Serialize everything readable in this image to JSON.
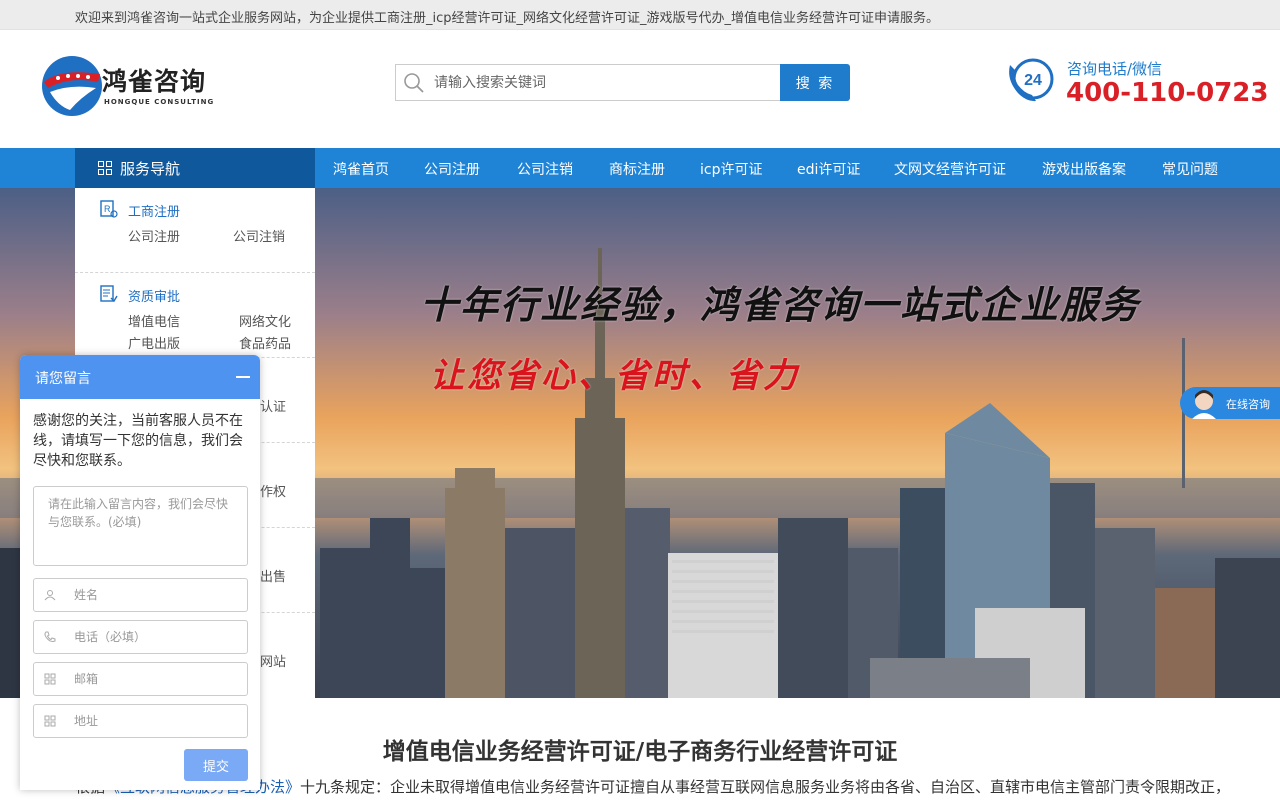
{
  "topbar": {
    "welcome_text": "欢迎来到鸿雀咨询一站式企业服务网站，为企业提供工商注册_icp经营许可证_网络文化经营许可证_游戏版号代办_增值电信业务经营许可证申请服务。"
  },
  "header": {
    "logo": {
      "title": "鸿雀咨询",
      "subtitle": "HONGQUE CONSULTING",
      "brand_color": "#1f6fc2"
    },
    "search": {
      "placeholder": "请输入搜索关键词",
      "button_label": "搜 索",
      "icon": "search-icon"
    },
    "hotline": {
      "badge": "24",
      "label": "咨询电话/微信",
      "number": "400-110-0723",
      "number_color": "#d92027"
    }
  },
  "nav": {
    "service_nav_label": "服务导航",
    "items": [
      {
        "label": "鸿雀首页"
      },
      {
        "label": "公司注册"
      },
      {
        "label": "公司注销"
      },
      {
        "label": "商标注册"
      },
      {
        "label": "icp许可证"
      },
      {
        "label": "edi许可证"
      },
      {
        "label": "文网文经营许可证"
      },
      {
        "label": "游戏出版备案"
      },
      {
        "label": "常见问题"
      }
    ],
    "bar_color": "#1f84d6",
    "head_color": "#10589c"
  },
  "service_menu": {
    "groups": [
      {
        "title": "工商注册",
        "icon": "registration-icon",
        "links": [
          "公司注册",
          "公司注销"
        ]
      },
      {
        "title": "资质审批",
        "icon": "document-icon",
        "links": [
          "增值电信",
          "网络文化",
          "广电出版",
          "食品药品"
        ]
      }
    ],
    "partial_visible_labels": [
      "认证",
      "作权",
      "出售",
      "网站"
    ]
  },
  "banner": {
    "headline": "十年行业经验，鸿雀咨询一站式企业服务",
    "tagline": "让您省心、省时、省力"
  },
  "float_consult": {
    "label": "在线咨询"
  },
  "content": {
    "title": "增值电信业务经营许可证/电子商务行业经营许可证",
    "text_prefix": "根据",
    "text_law": "《互联网信息服务管理办法》",
    "text_body": "十九条规定：企业未取得增值电信业务经营许可证擅自从事经营互联网信息服务业务将由各省、自治区、直辖市电信主管部门责令限期改正，"
  },
  "message_panel": {
    "title": "请您留言",
    "intro": "感谢您的关注，当前客服人员不在线，请填写一下您的信息，我们会尽快和您联系。",
    "message_placeholder": "请在此输入留言内容，我们会尽快与您联系。(必填)",
    "fields": [
      {
        "placeholder": "姓名",
        "icon": "user-icon"
      },
      {
        "placeholder": "电话（必填）",
        "icon": "phone-icon"
      },
      {
        "placeholder": "邮箱",
        "icon": "mail-icon"
      },
      {
        "placeholder": "地址",
        "icon": "address-icon"
      }
    ],
    "submit_label": "提交",
    "header_color": "#4f93f0"
  }
}
